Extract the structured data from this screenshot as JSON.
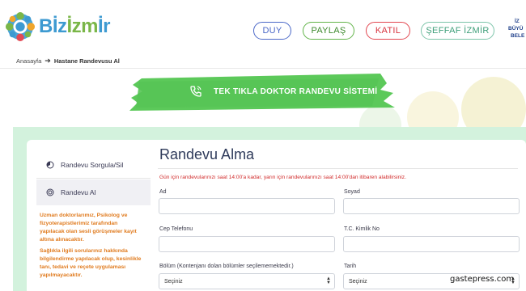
{
  "header": {
    "logo_text_blue": "Bİz",
    "logo_text_green": "İzm",
    "logo_text_end": "İr",
    "nav": {
      "duy": "DUY",
      "paylas": "PAYLAŞ",
      "katil": "KATIL",
      "seffaf": "ŞEFFAF İZMİR"
    },
    "corner_logo_line1": "İZ",
    "corner_logo_line2": "BÜYÜ",
    "corner_logo_line3": "BELE"
  },
  "breadcrumb": {
    "home": "Anasayfa",
    "current": "Hastane Randevusu Al"
  },
  "hero": {
    "title": "TEK TIKLA DOKTOR RANDEVU SİSTEMİ"
  },
  "sidebar": {
    "items": [
      {
        "label": "Randevu Sorgula/Sil",
        "icon": "calendar-pie-icon"
      },
      {
        "label": "Randevu Al",
        "icon": "clock-icon"
      }
    ],
    "note1": "Uzman doktorlarımız, Psikolog ve fizyoterapistlerimiz tarafından yapılacak olan sesli görüşmeler kayıt altına alınacaktır.",
    "note2": "Sağlıkla ilgili sorularınız hakkında bilgilendirme yapılacak olup, kesinlikle tanı, tedavi ve reçete uygulaması yapılmayacaktır."
  },
  "form": {
    "title": "Randevu Alma",
    "notice": "Gün için randevularınızı saat 14:00'a kadar, yarın için randevularınızı saat 14:00'dan itibaren alabilirsiniz.",
    "fields": {
      "ad": {
        "label": "Ad",
        "value": ""
      },
      "soyad": {
        "label": "Soyad",
        "value": ""
      },
      "telefon": {
        "label": "Cep Telefonu",
        "value": ""
      },
      "tc": {
        "label": "T.C. Kimlik No",
        "value": ""
      },
      "bolum": {
        "label": "Bölüm (Kontenjanı dolan bölümler seçilememektedir.)",
        "value": "Seçiniz"
      },
      "tarih": {
        "label": "Tarih",
        "value": "Seçiniz"
      }
    }
  },
  "watermark": "gastepress.com",
  "colors": {
    "hero_green": "#5cc95a",
    "content_bg": "#d3f2dd",
    "notice_red": "#d12b2b",
    "note_orange": "#e07b1f"
  }
}
